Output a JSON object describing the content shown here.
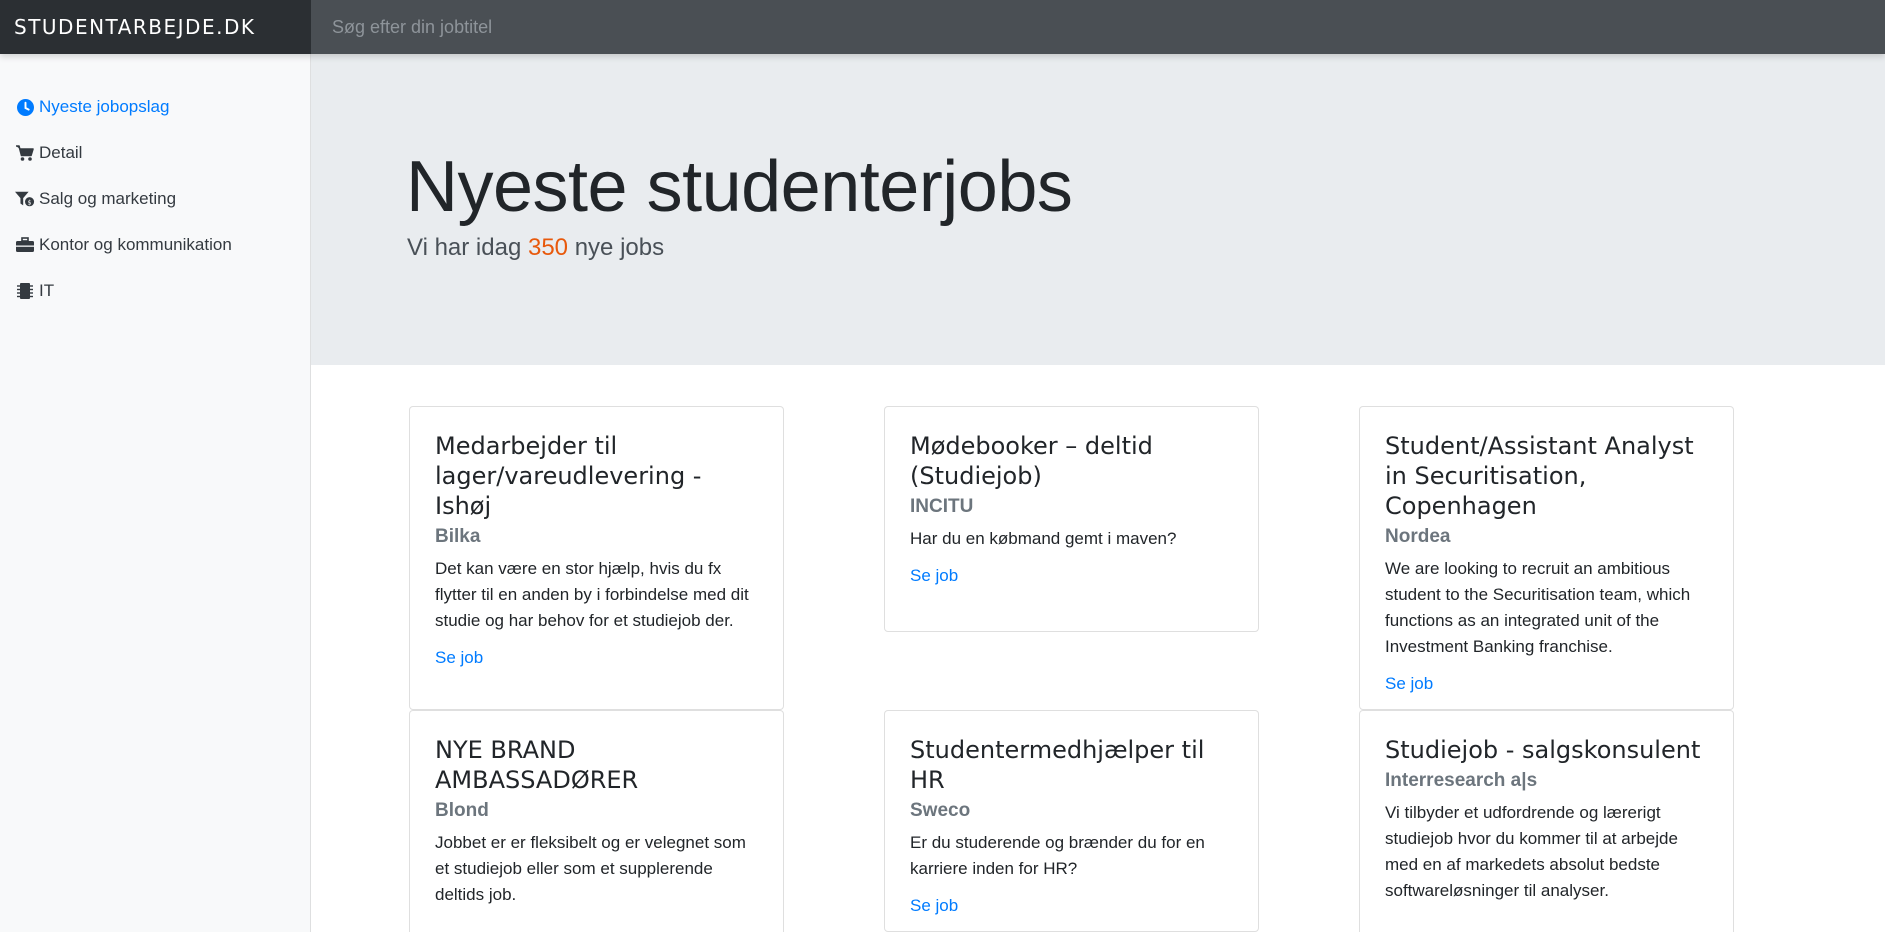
{
  "brand": "STUDENTARBEJDE.DK",
  "search": {
    "placeholder": "Søg efter din jobtitel"
  },
  "sidebar": {
    "items": [
      {
        "label": "Nyeste jobopslag",
        "icon": "clock-icon"
      },
      {
        "label": "Detail",
        "icon": "cart-icon"
      },
      {
        "label": "Salg og marketing",
        "icon": "funnel-dollar-icon"
      },
      {
        "label": "Kontor og kommunikation",
        "icon": "briefcase-icon"
      },
      {
        "label": "IT",
        "icon": "microchip-icon"
      }
    ]
  },
  "jumbotron": {
    "title": "Nyeste studenterjobs",
    "lead_prefix": "Vi har idag",
    "count": "350",
    "lead_suffix": "nye jobs"
  },
  "jobs": [
    {
      "title": "Medarbejder til lager/vareudlevering - Ishøj",
      "company": "Bilka",
      "description": "Det kan være en stor hjælp, hvis du fx flytter til en anden by i forbindelse med dit studie og har behov for et studiejob der.",
      "link": "Se job"
    },
    {
      "title": "Mødebooker – deltid (Studiejob)",
      "company": "INCITU",
      "description": "Har du en købmand gemt i maven?",
      "link": "Se job"
    },
    {
      "title": "Student/Assistant Analyst in Securitisation, Copenhagen",
      "company": "Nordea",
      "description": "We are looking to recruit an ambitious student to the Securitisation team, which functions as an integrated unit of the Investment Banking franchise.",
      "link": "Se job"
    },
    {
      "title": "NYE BRAND AMBASSADØRER",
      "company": "Blond",
      "description": "Jobbet er er fleksibelt og er velegnet som et studiejob eller som et supplerende deltids job.",
      "link": ""
    },
    {
      "title": "Studentermedhjælper til HR",
      "company": "Sweco",
      "description": "Er du studerende og brænder du for en karriere inden for HR?",
      "link": "Se job"
    },
    {
      "title": "Studiejob - salgskonsulent",
      "company": "Interresearch a|s",
      "description": "Vi tilbyder et udfordrende og lærerigt studiejob hvor du kommer til at arbejde med en af markedets absolut bedste softwareløsninger til analyser.",
      "link": ""
    }
  ],
  "colors": {
    "accent": "#007bff",
    "navbar": "#343a40",
    "count": "#e8590c",
    "jumbotron": "#e9ecef"
  }
}
